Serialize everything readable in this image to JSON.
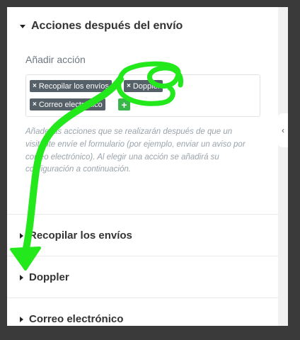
{
  "panel": {
    "active_section": "Acciones después del envío",
    "field_label": "Añadir acción",
    "tags": [
      {
        "label": "Recopilar los envíos"
      },
      {
        "label": "Doppler"
      },
      {
        "label": "Correo electrónico"
      }
    ],
    "add_tag_symbol": "+",
    "remove_symbol": "×",
    "help_text": "Añade las acciones que se realizarán después de que un visitante envíe el formulario (por ejemplo, enviar un aviso por correo electrónico). Al elegir una acción se añadirá su configuración a continuación.",
    "sections": [
      {
        "label": "Recopilar los envíos"
      },
      {
        "label": "Doppler"
      },
      {
        "label": "Correo electrónico"
      }
    ],
    "collapse_glyph": "‹"
  },
  "colors": {
    "background": "#3a3a3a",
    "tag_bg": "#556068",
    "add_btn": "#39b54a",
    "annotation": "#22e81c"
  },
  "icons": [
    "caret-down-icon",
    "caret-right-icon",
    "remove-icon",
    "plus-icon",
    "chevron-left-icon"
  ]
}
